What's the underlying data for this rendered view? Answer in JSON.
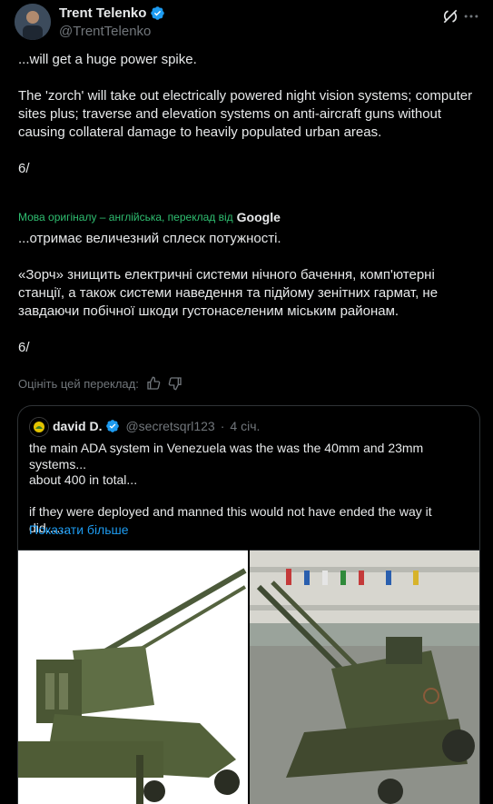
{
  "author": {
    "name": "Trent Telenko",
    "handle": "@TrentTelenko"
  },
  "tweet": {
    "original_text": "...will get a huge power spike.\n\nThe 'zorch' will take out electrically powered night vision systems; computer sites plus; traverse and elevation systems on anti-aircraft guns without causing collateral damage to heavily populated urban areas.\n\n6/",
    "translation_note": "Мова оригіналу – англійська, переклад від",
    "translation_provider": "Google",
    "translated_text": "...отримає величезний сплеск потужності.\n\n«Зорч» знищить електричні системи нічного бачення, комп'ютерні станції, а також системи наведення та підйому зенітних гармат, не завдаючи побічної шкоди густонаселеним міським районам.\n\n6/",
    "rate_label": "Оцініть цей переклад:"
  },
  "quote": {
    "name": "david D.",
    "handle": "@secretsqrl123",
    "separator": "·",
    "time": "4 січ.",
    "text": "the main ADA system in Venezuela was the was the 40mm and 23mm systems...\nabout 400 in total...\n\nif they were deployed and manned this would not have ended the way it did......",
    "show_more": "Показати більше"
  },
  "colors": {
    "background": "#000000",
    "text": "#e7e9ea",
    "secondary": "#71767b",
    "link": "#1d9bf0",
    "verified": "#1d9bf0"
  },
  "icons": [
    "verified-badge-icon",
    "grok-icon",
    "more-icon",
    "thumbs-up-icon",
    "thumbs-down-icon"
  ]
}
